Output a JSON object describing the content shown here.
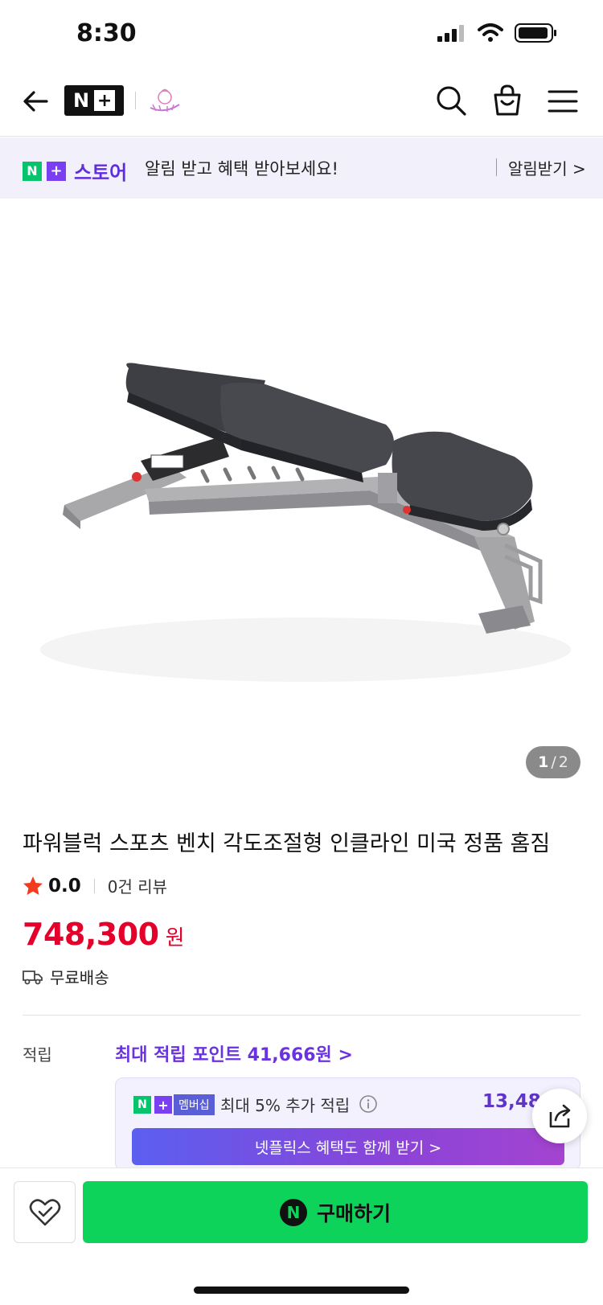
{
  "status_bar": {
    "time": "8:30"
  },
  "header": {
    "logo_text": "N",
    "logo_plus": "+"
  },
  "promo": {
    "logo_n": "N",
    "logo_plus": "+",
    "logo_word": "스토어",
    "text": "알림 받고 혜택 받아보세요!",
    "action": "알림받기 >"
  },
  "gallery": {
    "current": "1",
    "separator": "/",
    "total": "2"
  },
  "product": {
    "title": "파워블럭 스포츠 벤치 각도조절형 인클라인 미국 정품 홈짐",
    "rating": "0.0",
    "review_count": "0건 리뷰",
    "price": "748,300",
    "price_unit": "원",
    "shipping": "무료배송"
  },
  "points": {
    "label": "적립",
    "max": "최대 적립 포인트 41,666원 >",
    "member_badge_n": "N",
    "member_badge_plus": "+",
    "member_badge_word": "멤버십",
    "member_text": "최대 5% 추가 적립",
    "member_amount": "13,48",
    "netflix": "넷플릭스 혜택도 함께 받기 >"
  },
  "bottom": {
    "buy_n": "N",
    "buy_label": "구매하기"
  },
  "colors": {
    "price": "#e4002b",
    "accent": "#6a32e0",
    "buy": "#0ed35b"
  }
}
